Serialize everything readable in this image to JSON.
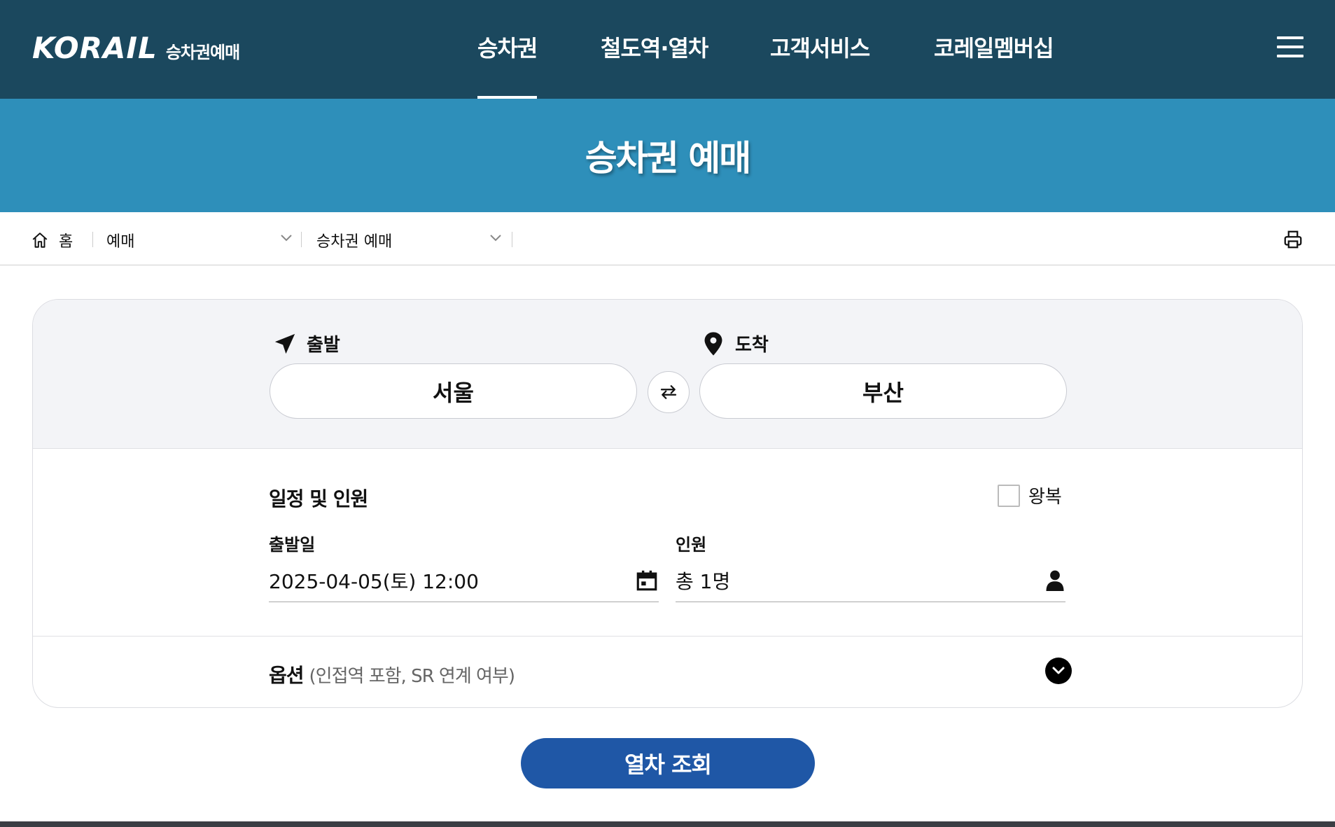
{
  "header": {
    "logo_text": "KORAIL",
    "logo_subtitle": "승차권예매",
    "nav": [
      {
        "label": "승차권",
        "active": true
      },
      {
        "label": "철도역·열차",
        "active": false
      },
      {
        "label": "고객서비스",
        "active": false
      },
      {
        "label": "코레일멤버십",
        "active": false
      }
    ],
    "menu_icon": "hamburger-menu-icon"
  },
  "hero": {
    "title": "승차권 예매"
  },
  "breadcrumb": {
    "home_icon": "home-icon",
    "home_label": "홈",
    "level1": "예매",
    "level2": "승차권 예매",
    "print_icon": "printer-icon"
  },
  "route": {
    "departure_label": "출발",
    "departure_icon": "paper-plane-icon",
    "departure_station": "서울",
    "arrival_label": "도착",
    "arrival_icon": "location-pin-icon",
    "arrival_station": "부산",
    "swap_icon": "swap-arrows-icon"
  },
  "schedule": {
    "title": "일정 및 인원",
    "roundtrip_label": "왕복",
    "roundtrip_checked": false,
    "date_label": "출발일",
    "date_value": "2025-04-05(토) 12:00",
    "date_icon": "calendar-icon",
    "passenger_label": "인원",
    "passenger_value": "총 1명",
    "passenger_icon": "person-icon"
  },
  "options": {
    "title": "옵션",
    "subtitle": "(인접역 포함, SR 연계 여부)",
    "toggle_icon": "chevron-down-circle-icon"
  },
  "search_button": "열차 조회",
  "colors": {
    "header_bg": "#1b485e",
    "hero_bg": "#2e8fba",
    "primary_button": "#1f57a6",
    "route_panel_bg": "#f3f4f7"
  }
}
